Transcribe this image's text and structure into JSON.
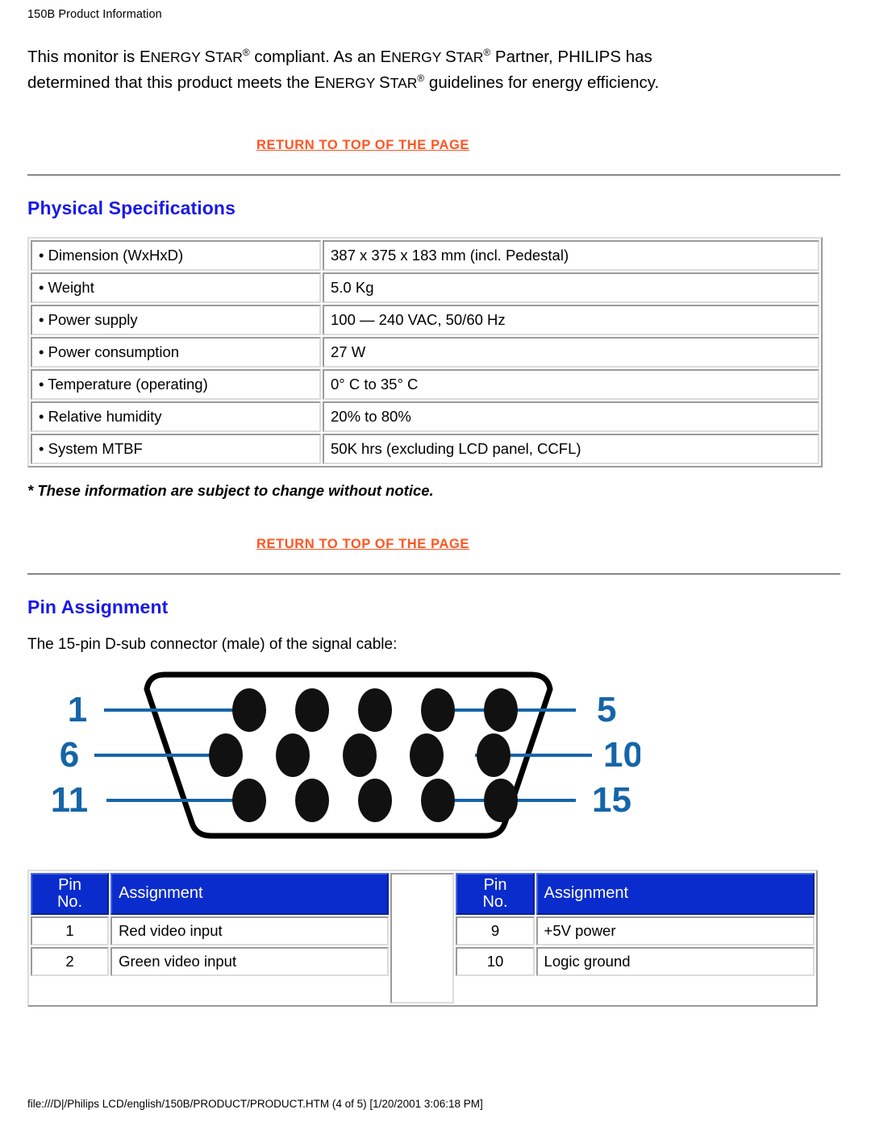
{
  "page": {
    "header_title": "150B Product Information",
    "footer_path": "file:///D|/Philips LCD/english/150B/PRODUCT/PRODUCT.HTM (4 of 5) [1/20/2001 3:06:18 PM]"
  },
  "intro": {
    "p1_a": "This monitor is ",
    "energy": "E",
    "nergy": "NERGY ",
    "s": "S",
    "tar": "TAR",
    "p1_b": " compliant. As an ",
    "p1_c": " Partner, ",
    "philips": "PHILIPS",
    "p1_d": " has determined that this product meets the ",
    "p1_e": " guidelines for energy efficiency."
  },
  "links": {
    "return_top_1": "RETURN TO TOP OF THE PAGE",
    "return_top_2": "RETURN TO TOP OF THE PAGE"
  },
  "sections": {
    "physical_specifications": {
      "title": "Physical Specifications",
      "note": "* These information are subject to change without notice.",
      "rows": [
        {
          "label": "• Dimension (WxHxD)",
          "value": "387 x 375 x 183 mm (incl. Pedestal)"
        },
        {
          "label": "• Weight",
          "value": "5.0 Kg"
        },
        {
          "label": "• Power supply",
          "value": "100 — 240 VAC, 50/60 Hz"
        },
        {
          "label": "• Power consumption",
          "value": "27 W"
        },
        {
          "label": "• Temperature (operating)",
          "value": "0° C to 35° C"
        },
        {
          "label": "• Relative humidity",
          "value": "20% to 80%"
        },
        {
          "label": "• System MTBF",
          "value": "50K hrs (excluding LCD panel, CCFL)"
        }
      ]
    },
    "pin_assignment": {
      "title": "Pin Assignment",
      "description": "The 15-pin D-sub connector (male) of the signal cable:",
      "diagram": {
        "labels_left": [
          "1",
          "6",
          "11"
        ],
        "labels_right": [
          "5",
          "10",
          "15"
        ],
        "rows": 3,
        "pins_per_row": 5,
        "label_color": "#1565a8"
      },
      "table": {
        "header_pin_no_line1": "Pin",
        "header_pin_no_line2": "No.",
        "header_assignment": "Assignment",
        "header_bg": "#0a2ccc",
        "left_rows": [
          {
            "pin": "1",
            "assignment": "Red video input"
          },
          {
            "pin": "2",
            "assignment": "Green video input"
          }
        ],
        "right_rows": [
          {
            "pin": "9",
            "assignment": "+5V power"
          },
          {
            "pin": "10",
            "assignment": "Logic ground"
          }
        ]
      }
    }
  },
  "colors": {
    "link": "#ff5522",
    "heading": "#1a1ae6",
    "table_header": "#0a2ccc"
  }
}
